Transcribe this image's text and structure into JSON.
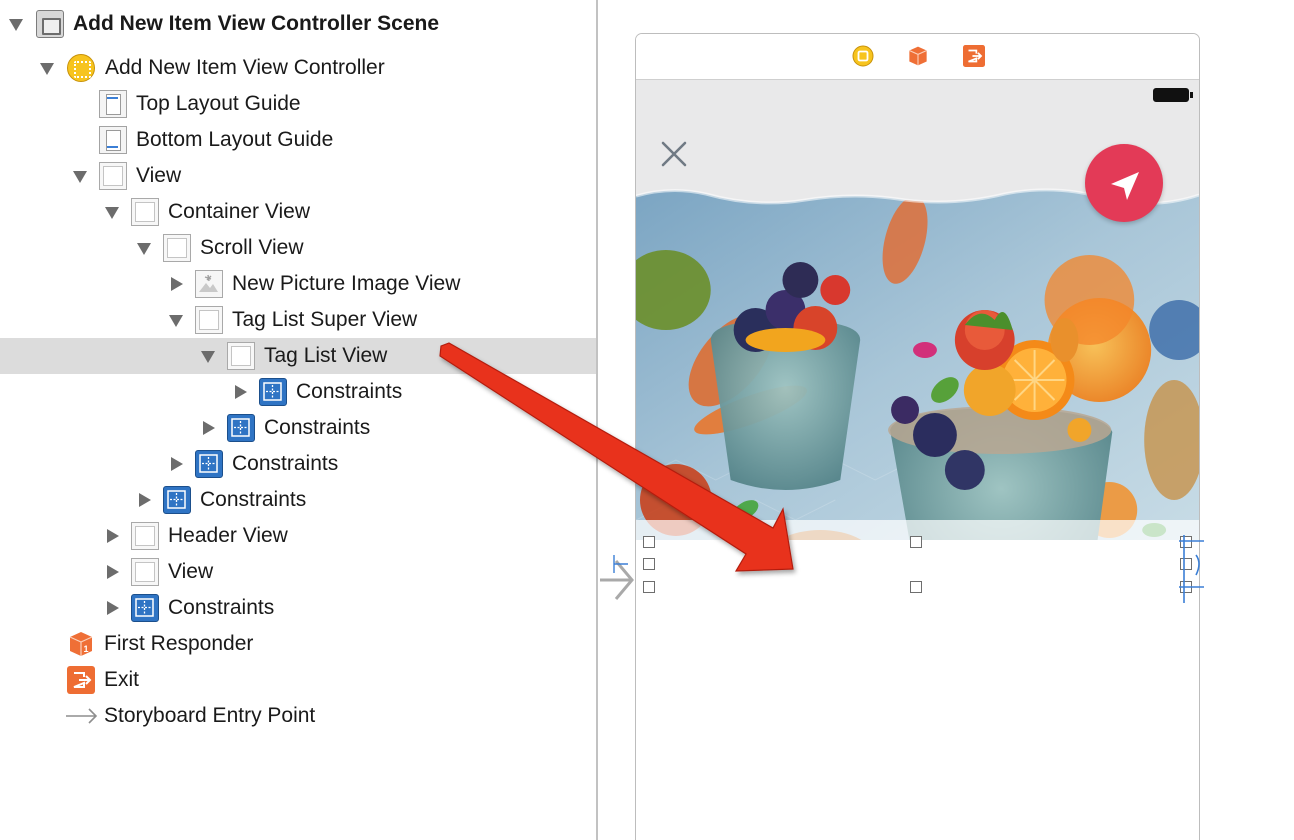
{
  "outline": {
    "items": [
      {
        "label": "Add New Item View Controller Scene"
      },
      {
        "label": "Add New Item View Controller"
      },
      {
        "label": "Top Layout Guide"
      },
      {
        "label": "Bottom Layout Guide"
      },
      {
        "label": "View"
      },
      {
        "label": "Container View"
      },
      {
        "label": "Scroll View"
      },
      {
        "label": "New Picture Image View"
      },
      {
        "label": "Tag List Super View"
      },
      {
        "label": "Tag List View"
      },
      {
        "label": "Constraints"
      },
      {
        "label": "Constraints"
      },
      {
        "label": "Constraints"
      },
      {
        "label": "Constraints"
      },
      {
        "label": "Header View"
      },
      {
        "label": "View"
      },
      {
        "label": "Constraints"
      },
      {
        "label": "First Responder"
      },
      {
        "label": "Exit"
      },
      {
        "label": "Storyboard Entry Point"
      }
    ],
    "selected_item": "Tag List View"
  },
  "canvas": {
    "scene_dock_icons": [
      "view-controller-icon",
      "first-responder-icon",
      "exit-icon"
    ],
    "device_buttons": [
      "close-icon",
      "send-icon"
    ],
    "photo_subject": "food-photo"
  },
  "colors": {
    "selection": "#dcdcdc",
    "accent_red": "#e33a57",
    "constraint_blue": "#2f74c4",
    "vc_yellow": "#f7c41e",
    "exit_orange": "#ee6d33",
    "drag_arrow": "#e8301c"
  }
}
